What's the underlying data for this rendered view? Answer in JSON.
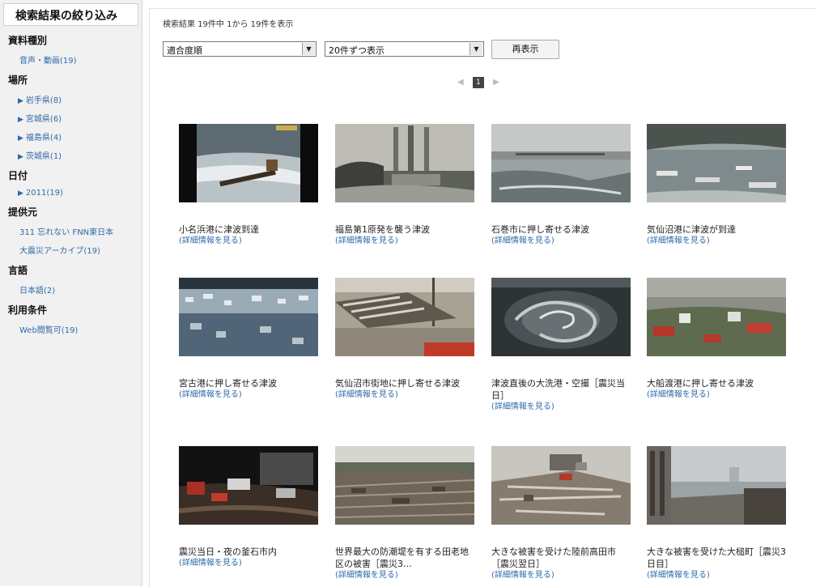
{
  "sidebar": {
    "title": "検索結果の絞り込み",
    "facets": [
      {
        "heading": "資料種別",
        "items": [
          {
            "label": "音声・動画(19)",
            "arrow": false
          }
        ]
      },
      {
        "heading": "場所",
        "items": [
          {
            "label": "岩手県(8)",
            "arrow": true
          },
          {
            "label": "宮城県(6)",
            "arrow": true
          },
          {
            "label": "福島県(4)",
            "arrow": true
          },
          {
            "label": "茨城県(1)",
            "arrow": true
          }
        ]
      },
      {
        "heading": "日付",
        "items": [
          {
            "label": "2011(19)",
            "arrow": true
          }
        ]
      },
      {
        "heading": "提供元",
        "items": [
          {
            "label": "311 忘れない FNN東日本",
            "arrow": false
          },
          {
            "label": "大震災アーカイブ(19)",
            "arrow": false
          }
        ]
      },
      {
        "heading": "言語",
        "items": [
          {
            "label": "日本語(2)",
            "arrow": false
          }
        ]
      },
      {
        "heading": "利用条件",
        "items": [
          {
            "label": "Web閲覧可(19)",
            "arrow": false
          }
        ]
      }
    ]
  },
  "main": {
    "count_text": "検索結果 19件中 1から 19件を表示",
    "sort_select": "適合度順",
    "per_page_select": "20件ずつ表示",
    "redisplay_label": "再表示",
    "pager": {
      "prev": "◀",
      "current": "1",
      "next": "▶"
    },
    "detail_link": "(詳細情報を見る)",
    "results": [
      {
        "title": "小名浜港に津波到達",
        "scene": "night"
      },
      {
        "title": "福島第1原発を襲う津波",
        "scene": "plant"
      },
      {
        "title": "石巻市に押し寄せる津波",
        "scene": "bay"
      },
      {
        "title": "気仙沼港に津波が到達",
        "scene": "harbor"
      },
      {
        "title": "宮古港に押し寄せる津波",
        "scene": "flood"
      },
      {
        "title": "気仙沼市街地に押し寄せる津波",
        "scene": "town"
      },
      {
        "title": "津波直後の大洗港・空撮［震災当日］",
        "scene": "whirl"
      },
      {
        "title": "大船渡港に押し寄せる津波",
        "scene": "wave"
      },
      {
        "title": "震災当日・夜の釜石市内",
        "scene": "ruins"
      },
      {
        "title": "世界最大の防潮堤を有する田老地区の被害［震災3…",
        "scene": "debris"
      },
      {
        "title": "大きな被害を受けた陸前高田市［震災翌日］",
        "scene": "wreck"
      },
      {
        "title": "大きな被害を受けた大槌町［震災3日目］",
        "scene": "coast"
      }
    ]
  },
  "colors": {
    "link": "#2f6aa8",
    "sidebar_bg": "#f1f1f1",
    "pager_current": "#444444"
  }
}
